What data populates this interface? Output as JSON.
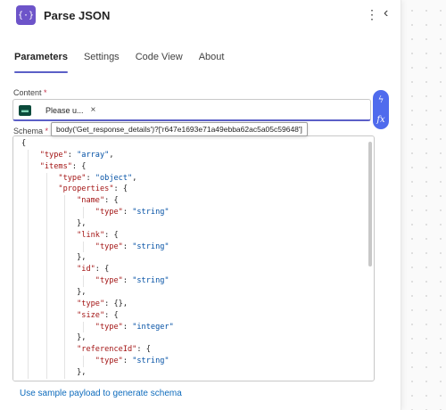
{
  "header": {
    "icon_glyph": "{·}",
    "title": "Parse JSON",
    "more_glyph": "⋮",
    "collapse_glyph": "‹"
  },
  "tabs": [
    {
      "label": "Parameters",
      "active": true
    },
    {
      "label": "Settings",
      "active": false
    },
    {
      "label": "Code View",
      "active": false
    },
    {
      "label": "About",
      "active": false
    }
  ],
  "content": {
    "label": "Content",
    "required_mark": "*",
    "token_text": "Please u...",
    "token_close": "×",
    "tooltip": "body('Get_response_details')?['r647e1693e71a49ebba62ac5a05c59648']",
    "dynamic_btn": "ϟ",
    "expression_btn": "fx"
  },
  "schema": {
    "label": "Schema",
    "required_mark": "*",
    "lines": [
      {
        "indent": 0,
        "text": "{"
      },
      {
        "indent": 1,
        "key": "\"type\"",
        "rest": ": ",
        "val": "\"array\"",
        "tail": ","
      },
      {
        "indent": 1,
        "key": "\"items\"",
        "rest": ": {"
      },
      {
        "indent": 2,
        "key": "\"type\"",
        "rest": ": ",
        "val": "\"object\"",
        "tail": ","
      },
      {
        "indent": 2,
        "key": "\"properties\"",
        "rest": ": {"
      },
      {
        "indent": 3,
        "key": "\"name\"",
        "rest": ": {"
      },
      {
        "indent": 4,
        "key": "\"type\"",
        "rest": ": ",
        "val": "\"string\""
      },
      {
        "indent": 3,
        "text": "},"
      },
      {
        "indent": 3,
        "key": "\"link\"",
        "rest": ": {"
      },
      {
        "indent": 4,
        "key": "\"type\"",
        "rest": ": ",
        "val": "\"string\""
      },
      {
        "indent": 3,
        "text": "},"
      },
      {
        "indent": 3,
        "key": "\"id\"",
        "rest": ": {"
      },
      {
        "indent": 4,
        "key": "\"type\"",
        "rest": ": ",
        "val": "\"string\""
      },
      {
        "indent": 3,
        "text": "},"
      },
      {
        "indent": 3,
        "key": "\"type\"",
        "rest": ": {},"
      },
      {
        "indent": 3,
        "key": "\"size\"",
        "rest": ": {"
      },
      {
        "indent": 4,
        "key": "\"type\"",
        "rest": ": ",
        "val": "\"integer\""
      },
      {
        "indent": 3,
        "text": "},"
      },
      {
        "indent": 3,
        "key": "\"referenceId\"",
        "rest": ": {"
      },
      {
        "indent": 4,
        "key": "\"type\"",
        "rest": ": ",
        "val": "\"string\""
      },
      {
        "indent": 3,
        "text": "},"
      }
    ]
  },
  "footer_link": "Use sample payload to generate schema"
}
